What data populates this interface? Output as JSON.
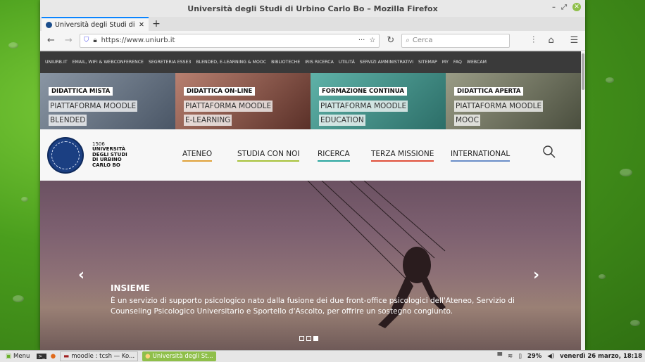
{
  "window": {
    "title": "Università degli Studi di Urbino Carlo Bo – Mozilla Firefox"
  },
  "tab": {
    "title": "Università degli Studi di Urbi",
    "new_tab": "+"
  },
  "nav": {
    "url": "https://www.uniurb.it",
    "search_placeholder": "Cerca",
    "more": "···"
  },
  "topstrip": [
    "UNIURB.IT",
    "EMAIL, WIFI & WEBCONFERENCE",
    "SEGRETERIA ESSE3",
    "BLENDED, E-LEARNING & MOOC",
    "BIBLIOTECHE",
    "IRIS RICERCA",
    "UTILITÀ",
    "SERVIZI AMMINISTRATIVI",
    "SITEMAP",
    "MY",
    "FAQ",
    "WEBCAM"
  ],
  "banners": [
    {
      "heading": "DIDATTICA MISTA",
      "line1": "PIATTAFORMA MOODLE",
      "line2": "BLENDED",
      "color": "#5e6a78"
    },
    {
      "heading": "DIDATTICA ON-LINE",
      "line1": "PIATTAFORMA MOODLE",
      "line2": "E-LEARNING",
      "color": "#7a4a40"
    },
    {
      "heading": "FORMAZIONE CONTINUA",
      "line1": "PIATTAFORMA MOODLE",
      "line2": "EDUCATION",
      "color": "#3e8e84"
    },
    {
      "heading": "DIDATTICA APERTA",
      "line1": "PIATTAFORMA MOODLE",
      "line2": "MOOC",
      "color": "#6a6e5a"
    }
  ],
  "brand": {
    "year": "1506",
    "l1": "UNIVERSITÀ",
    "l2": "DEGLI STUDI",
    "l3": "DI URBINO",
    "l4": "CARLO BO"
  },
  "menu": [
    {
      "label": "ATENEO",
      "color": "#e0a23a"
    },
    {
      "label": "STUDIA CON NOI",
      "color": "#a8c23a"
    },
    {
      "label": "RICERCA",
      "color": "#2aa6a0"
    },
    {
      "label": "TERZA MISSIONE",
      "color": "#e0503a"
    },
    {
      "label": "INTERNATIONAL",
      "color": "#6a8ec8"
    }
  ],
  "hero": {
    "title": "INSIEME",
    "text": "È un servizio di supporto psicologico nato dalla fusione dei due front-office psicologici dell'Ateneo, Servizio di Counseling Psicologico Universitario e Sportello d'Ascolto, per offrire un sostegno congiunto.",
    "prev": "‹",
    "next": "›"
  },
  "taskbar": {
    "menu": "Menu",
    "app1": "moodle : tcsh — Ko...",
    "app2": "Università degli St...",
    "battery": "29%",
    "clock": "venerdì 26 marzo, 18:18"
  }
}
